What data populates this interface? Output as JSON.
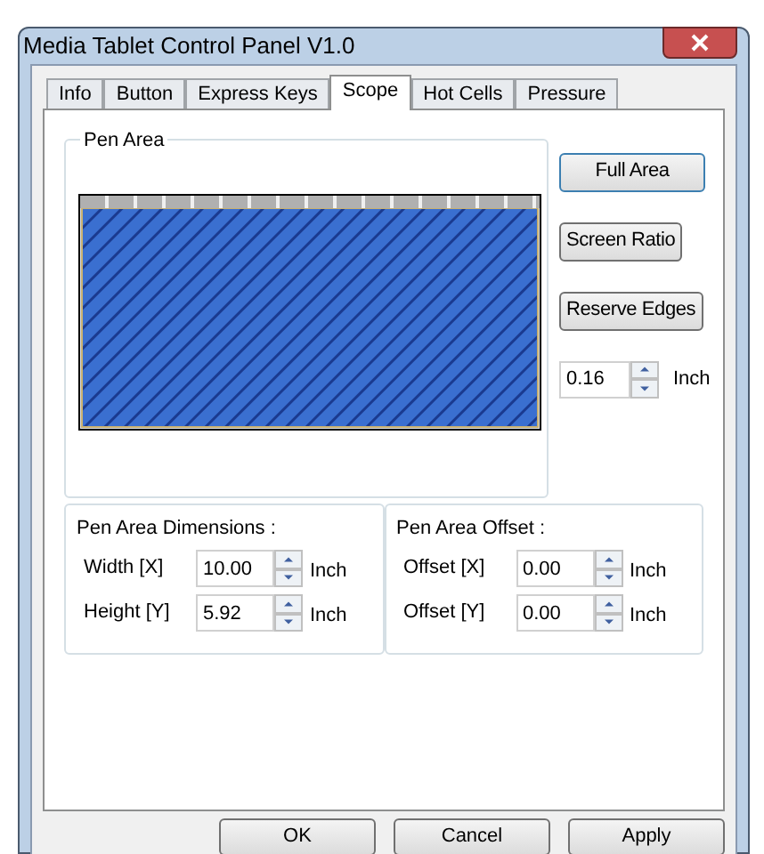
{
  "window": {
    "title": "Media Tablet Control Panel V1.0"
  },
  "tabs": [
    {
      "label": "Info",
      "selected": false
    },
    {
      "label": "Button",
      "selected": false
    },
    {
      "label": "Express Keys",
      "selected": false
    },
    {
      "label": "Scope",
      "selected": true
    },
    {
      "label": "Hot Cells",
      "selected": false
    },
    {
      "label": "Pressure",
      "selected": false
    }
  ],
  "pen_area": {
    "title": "Pen Area",
    "buttons": [
      "Full Area",
      "Screen Ratio",
      "Reserve Edges"
    ],
    "edge": {
      "value": "0.16",
      "unit": "Inch"
    }
  },
  "dimensions": {
    "title": "Pen Area Dimensions :",
    "fields": [
      {
        "label": "Width [X]",
        "value": "10.00",
        "unit": "Inch"
      },
      {
        "label": "Height [Y]",
        "value": "5.92",
        "unit": "Inch"
      }
    ]
  },
  "offset": {
    "title": "Pen Area Offset :",
    "fields": [
      {
        "label": "Offset [X]",
        "value": "0.00",
        "unit": "Inch"
      },
      {
        "label": "Offset [Y]",
        "value": "0.00",
        "unit": "Inch"
      }
    ]
  },
  "buttons": [
    "OK",
    "Cancel",
    "Apply"
  ]
}
